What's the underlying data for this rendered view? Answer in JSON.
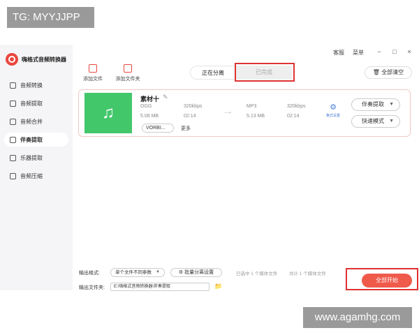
{
  "watermark_top": "TG: MYYJJPP",
  "watermark_bottom": "www.agamhg.com",
  "app": {
    "name": "嗨格式音频转换器"
  },
  "sidebar": {
    "items": [
      {
        "label": "音频转换"
      },
      {
        "label": "音频提取"
      },
      {
        "label": "音频合并"
      },
      {
        "label": "伴奏提取"
      },
      {
        "label": "乐器提取"
      },
      {
        "label": "音频压缩"
      }
    ]
  },
  "titlebar": {
    "service": "客服",
    "menu": "菜单",
    "minimize": "−",
    "maximize": "□",
    "close": "×"
  },
  "toolbar": {
    "add_file": "添加文件",
    "add_folder": "添加文件夹",
    "clear_all": "全部清空"
  },
  "tabs": {
    "separating": "正在分离",
    "completed": "已完成"
  },
  "file": {
    "name": "素材十",
    "input": {
      "format": "OGG",
      "bitrate": "320kbps",
      "size": "5.08 MB",
      "duration": "02:14"
    },
    "output": {
      "format": "MP3",
      "bitrate": "320kbps",
      "size": "5.13 MB",
      "duration": "02:14"
    },
    "codec": "VORBI...",
    "more": "更多",
    "output_settings": "格式设置",
    "mode": "伴奏提取",
    "speed": "快速模式"
  },
  "bottom": {
    "format_label": "输出格式:",
    "format_value": "单个文件不同参数",
    "batch_button": "批量分离设置",
    "folder_label": "输出文件夹:",
    "folder_path": "E:\\嗨格式音频转换器\\伴奏提取",
    "selected_text": "已选中 1 个媒体文件",
    "total_text": "共计 1 个媒体文件",
    "start_all": "全部开始"
  }
}
